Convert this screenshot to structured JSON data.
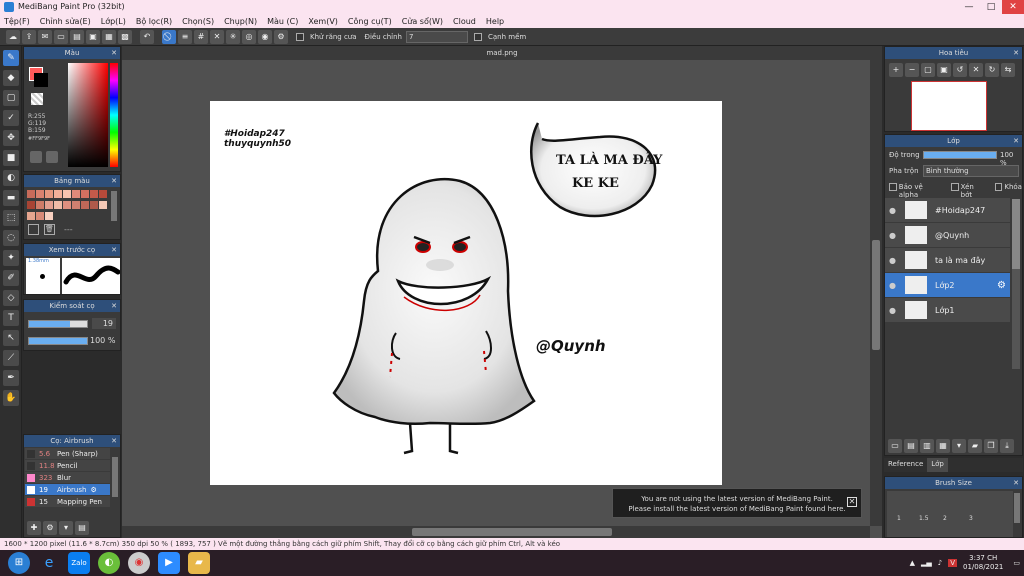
{
  "window": {
    "title": "MediBang Paint Pro (32bit)",
    "min": "—",
    "max": "□",
    "close": "✕"
  },
  "menu": [
    "Tệp(F)",
    "Chỉnh sửa(E)",
    "Lớp(L)",
    "Bộ lọc(R)",
    "Chọn(S)",
    "Chụp(N)",
    "Màu (C)",
    "Xem(V)",
    "Công cụ(T)",
    "Cửa sổ(W)",
    "Cloud",
    "Help"
  ],
  "toolbar": {
    "antialias": "Khử răng cưa",
    "adjust": "Điều chỉnh",
    "adjust_value": "7",
    "snap": "Cạnh mềm"
  },
  "color_panel": {
    "title": "Màu",
    "r": "R:255",
    "g": "G:119",
    "b": "B:159",
    "hex": "#FF9F9F"
  },
  "palette_panel": {
    "title": "Bảng màu",
    "dash": "---"
  },
  "brush_preview": {
    "title": "Xem trước cọ",
    "size": "1.38mm"
  },
  "brush_control": {
    "title": "Kiểm soát cọ",
    "size": "19",
    "opacity": "100 %",
    "size_frac": 0.7,
    "opacity_frac": 1.0
  },
  "brush_list": {
    "title": "Cọ: Airbrush",
    "items": [
      {
        "size": "5.6",
        "name": "Pen (Sharp)",
        "color": "#333333"
      },
      {
        "size": "11.8",
        "name": "Pencil",
        "color": "#333333"
      },
      {
        "size": "323",
        "name": "Blur",
        "color": "#ff88cc"
      },
      {
        "size": "19",
        "name": "Airbrush",
        "color": "#ffffff"
      },
      {
        "size": "15",
        "name": "Mapping Pen",
        "color": "#cc3333"
      }
    ]
  },
  "document": {
    "tab": "mad.png",
    "tag1": "#Hoidap247",
    "tag2": "thuyquynh50",
    "bubble1": "TA LÀ MA ĐÂY",
    "bubble2": "KE KE",
    "signature": "@Quynh"
  },
  "navigator": {
    "title": "Hoa tiêu"
  },
  "layer_panel": {
    "title": "Lớp",
    "opacity_label": "Độ trong",
    "opacity_value": "100 %",
    "blend_label": "Pha trộn",
    "blend_value": "Bình thường",
    "protect_alpha": "Bảo vệ alpha",
    "clipping": "Xén bớt",
    "lock": "Khóa",
    "layers": [
      {
        "name": "#Hoidap247"
      },
      {
        "name": "@Quynh"
      },
      {
        "name": "ta là ma đây"
      },
      {
        "name": "Lớp2"
      },
      {
        "name": "Lớp1"
      }
    ]
  },
  "bottom_tabs": {
    "reference": "Reference",
    "layer": "Lớp"
  },
  "brush_size_panel": {
    "title": "Brush Size",
    "sizes": [
      "1",
      "1.5",
      "2",
      "3"
    ]
  },
  "notice": {
    "line1": "You are not using the latest version of MediBang Paint.",
    "line2": "Please install the latest version of MediBang Paint found here."
  },
  "status": {
    "text": "1600 * 1200 pixel  (11.6 * 8.7cm)  350 dpi  50 %  ( 1893, 757 )  Vẽ một đường thẳng bằng cách giữ phím Shift, Thay đổi cỡ cọ bằng cách giữ phím Ctrl, Alt và kéo"
  },
  "taskbar": {
    "time": "3:37 CH",
    "date": "01/08/2021",
    "zalo": "Zalo"
  }
}
